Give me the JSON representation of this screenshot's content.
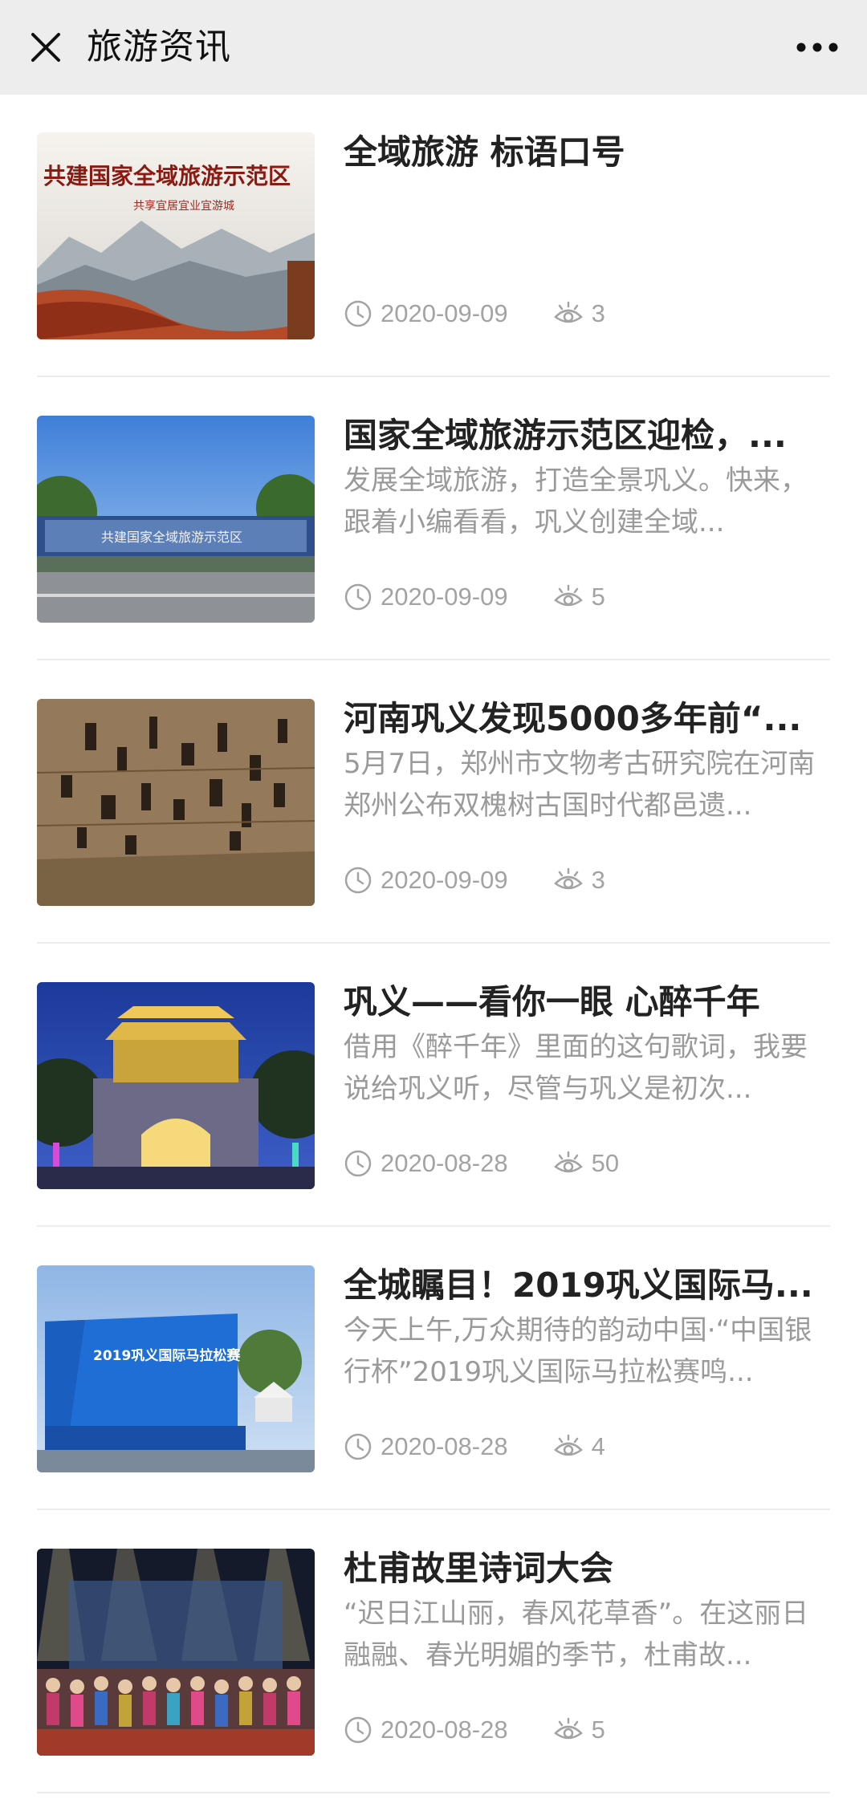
{
  "header": {
    "title": "旅游资讯",
    "close_icon": "close-icon",
    "more_icon": "more-dots-icon"
  },
  "articles": [
    {
      "title": "全域旅游 标语口号",
      "summary": "",
      "date": "2020-09-09",
      "views": "3",
      "image_text": "共建国家全域旅游示范区",
      "image_subtext": "共享宜居宜业宜游城"
    },
    {
      "title": "国家全域旅游示范区迎检，...",
      "summary": "发展全域旅游，打造全景巩义。快来，跟着小编看看，巩义创建全域...",
      "date": "2020-09-09",
      "views": "5",
      "image_text": "共建国家全域旅游示范区"
    },
    {
      "title": "河南巩义发现5000多年前“...",
      "summary": "5月7日，郑州市文物考古研究院在河南郑州公布双槐树古国时代都邑遗...",
      "date": "2020-09-09",
      "views": "3"
    },
    {
      "title": "巩义——看你一眼 心醉千年",
      "summary": "借用《醉千年》里面的这句歌词，我要说给巩义听，尽管与巩义是初次...",
      "date": "2020-08-28",
      "views": "50"
    },
    {
      "title": "全城瞩目！2019巩义国际马...",
      "summary": "今天上午,万众期待的韵动中国·“中国银行杯”2019巩义国际马拉松赛鸣...",
      "date": "2020-08-28",
      "views": "4",
      "image_text": "2019巩义国际马拉松赛"
    },
    {
      "title": "杜甫故里诗词大会",
      "summary": "“迟日江山丽，春风花草香”。在这丽日融融、春光明媚的季节，杜甫故...",
      "date": "2020-08-28",
      "views": "5"
    }
  ]
}
